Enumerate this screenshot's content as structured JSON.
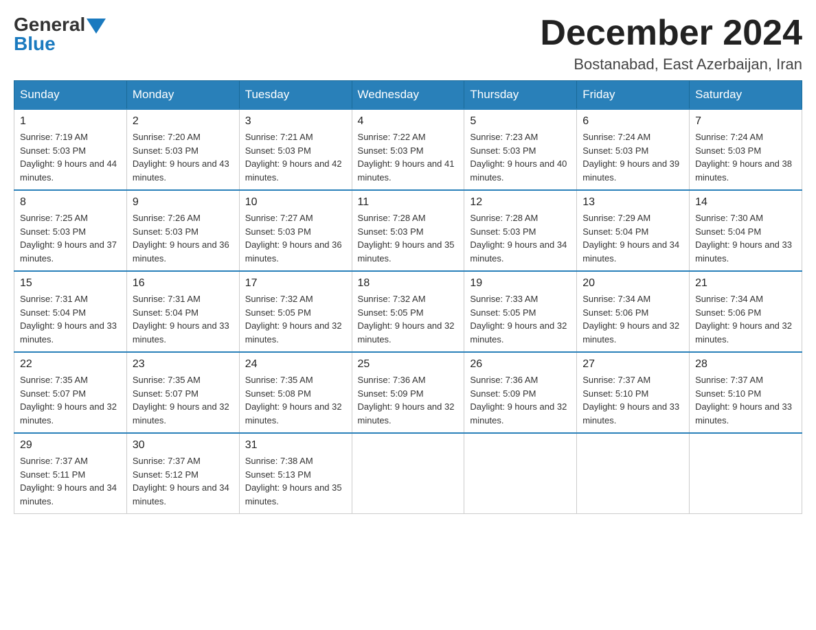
{
  "logo": {
    "general": "General",
    "blue": "Blue"
  },
  "title": "December 2024",
  "location": "Bostanabad, East Azerbaijan, Iran",
  "days": [
    "Sunday",
    "Monday",
    "Tuesday",
    "Wednesday",
    "Thursday",
    "Friday",
    "Saturday"
  ],
  "weeks": [
    [
      {
        "day": "1",
        "sunrise": "7:19 AM",
        "sunset": "5:03 PM",
        "daylight": "9 hours and 44 minutes."
      },
      {
        "day": "2",
        "sunrise": "7:20 AM",
        "sunset": "5:03 PM",
        "daylight": "9 hours and 43 minutes."
      },
      {
        "day": "3",
        "sunrise": "7:21 AM",
        "sunset": "5:03 PM",
        "daylight": "9 hours and 42 minutes."
      },
      {
        "day": "4",
        "sunrise": "7:22 AM",
        "sunset": "5:03 PM",
        "daylight": "9 hours and 41 minutes."
      },
      {
        "day": "5",
        "sunrise": "7:23 AM",
        "sunset": "5:03 PM",
        "daylight": "9 hours and 40 minutes."
      },
      {
        "day": "6",
        "sunrise": "7:24 AM",
        "sunset": "5:03 PM",
        "daylight": "9 hours and 39 minutes."
      },
      {
        "day": "7",
        "sunrise": "7:24 AM",
        "sunset": "5:03 PM",
        "daylight": "9 hours and 38 minutes."
      }
    ],
    [
      {
        "day": "8",
        "sunrise": "7:25 AM",
        "sunset": "5:03 PM",
        "daylight": "9 hours and 37 minutes."
      },
      {
        "day": "9",
        "sunrise": "7:26 AM",
        "sunset": "5:03 PM",
        "daylight": "9 hours and 36 minutes."
      },
      {
        "day": "10",
        "sunrise": "7:27 AM",
        "sunset": "5:03 PM",
        "daylight": "9 hours and 36 minutes."
      },
      {
        "day": "11",
        "sunrise": "7:28 AM",
        "sunset": "5:03 PM",
        "daylight": "9 hours and 35 minutes."
      },
      {
        "day": "12",
        "sunrise": "7:28 AM",
        "sunset": "5:03 PM",
        "daylight": "9 hours and 34 minutes."
      },
      {
        "day": "13",
        "sunrise": "7:29 AM",
        "sunset": "5:04 PM",
        "daylight": "9 hours and 34 minutes."
      },
      {
        "day": "14",
        "sunrise": "7:30 AM",
        "sunset": "5:04 PM",
        "daylight": "9 hours and 33 minutes."
      }
    ],
    [
      {
        "day": "15",
        "sunrise": "7:31 AM",
        "sunset": "5:04 PM",
        "daylight": "9 hours and 33 minutes."
      },
      {
        "day": "16",
        "sunrise": "7:31 AM",
        "sunset": "5:04 PM",
        "daylight": "9 hours and 33 minutes."
      },
      {
        "day": "17",
        "sunrise": "7:32 AM",
        "sunset": "5:05 PM",
        "daylight": "9 hours and 32 minutes."
      },
      {
        "day": "18",
        "sunrise": "7:32 AM",
        "sunset": "5:05 PM",
        "daylight": "9 hours and 32 minutes."
      },
      {
        "day": "19",
        "sunrise": "7:33 AM",
        "sunset": "5:05 PM",
        "daylight": "9 hours and 32 minutes."
      },
      {
        "day": "20",
        "sunrise": "7:34 AM",
        "sunset": "5:06 PM",
        "daylight": "9 hours and 32 minutes."
      },
      {
        "day": "21",
        "sunrise": "7:34 AM",
        "sunset": "5:06 PM",
        "daylight": "9 hours and 32 minutes."
      }
    ],
    [
      {
        "day": "22",
        "sunrise": "7:35 AM",
        "sunset": "5:07 PM",
        "daylight": "9 hours and 32 minutes."
      },
      {
        "day": "23",
        "sunrise": "7:35 AM",
        "sunset": "5:07 PM",
        "daylight": "9 hours and 32 minutes."
      },
      {
        "day": "24",
        "sunrise": "7:35 AM",
        "sunset": "5:08 PM",
        "daylight": "9 hours and 32 minutes."
      },
      {
        "day": "25",
        "sunrise": "7:36 AM",
        "sunset": "5:09 PM",
        "daylight": "9 hours and 32 minutes."
      },
      {
        "day": "26",
        "sunrise": "7:36 AM",
        "sunset": "5:09 PM",
        "daylight": "9 hours and 32 minutes."
      },
      {
        "day": "27",
        "sunrise": "7:37 AM",
        "sunset": "5:10 PM",
        "daylight": "9 hours and 33 minutes."
      },
      {
        "day": "28",
        "sunrise": "7:37 AM",
        "sunset": "5:10 PM",
        "daylight": "9 hours and 33 minutes."
      }
    ],
    [
      {
        "day": "29",
        "sunrise": "7:37 AM",
        "sunset": "5:11 PM",
        "daylight": "9 hours and 34 minutes."
      },
      {
        "day": "30",
        "sunrise": "7:37 AM",
        "sunset": "5:12 PM",
        "daylight": "9 hours and 34 minutes."
      },
      {
        "day": "31",
        "sunrise": "7:38 AM",
        "sunset": "5:13 PM",
        "daylight": "9 hours and 35 minutes."
      },
      null,
      null,
      null,
      null
    ]
  ]
}
